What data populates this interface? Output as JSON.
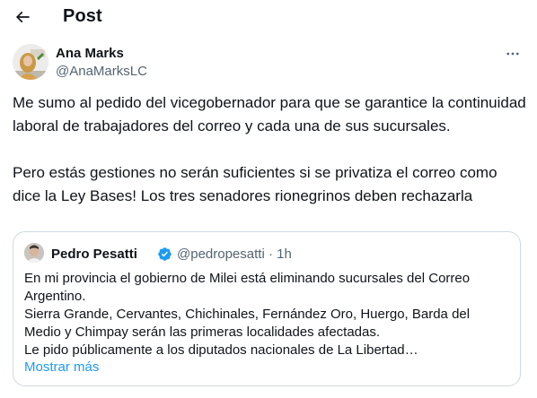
{
  "header": {
    "title": "Post",
    "back_icon": "arrow-left-icon"
  },
  "post": {
    "author": {
      "name": "Ana Marks",
      "handle": "@AnaMarksLC"
    },
    "more_icon": "more-horizontal-icon",
    "paragraphs": [
      "Me sumo al pedido del vicegobernador para que se garantice la continuidad laboral de trabajadores del correo y cada una de sus sucursales.",
      "Pero estás gestiones no serán suficientes si se privatiza el correo como dice la Ley Bases! Los tres senadores rionegrinos deben rechazarla"
    ]
  },
  "quote": {
    "author": {
      "name": "Pedro Pesatti",
      "handle": "@pedropesatti",
      "separator": "·",
      "time": "1h",
      "verified_icon": "verified-badge-icon"
    },
    "lines": [
      "En mi provincia el gobierno de Milei está eliminando sucursales del Correo Argentino.",
      "Sierra Grande, Cervantes, Chichinales, Fernández Oro, Huergo, Barda del Medio y Chimpay serán las primeras localidades afectadas.",
      "Le pido públicamente a los diputados nacionales de La Libertad…"
    ],
    "show_more": "Mostrar más"
  },
  "colors": {
    "accent": "#1d9bf0",
    "text": "#0f1419",
    "muted": "#536471",
    "border": "#cfd9de"
  }
}
